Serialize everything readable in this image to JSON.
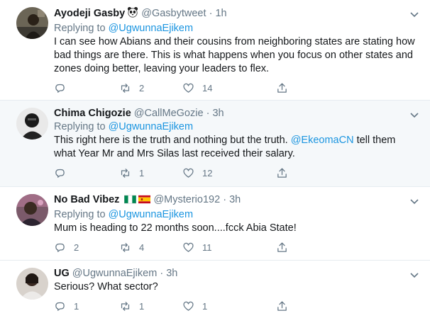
{
  "tweets": [
    {
      "name": "Ayodeji Gasby",
      "handle": "@Gasbytweet",
      "dot": "·",
      "time": "1h",
      "replying_prefix": "Replying to",
      "replying_to": "@UgwunnaEjikem",
      "text_plain": "I can see how Abians and their cousins from neighboring states are stating how bad things are there. This is what happens when you focus on other states and zones doing better, leaving your leaders to flex.",
      "reply_count": "",
      "retweet_count": "2",
      "like_count": "14",
      "emoji": "panda-face-icon",
      "highlight": false
    },
    {
      "name": "Chima Chigozie",
      "handle": "@CallMeGozie",
      "dot": "·",
      "time": "3h",
      "replying_prefix": "Replying to",
      "replying_to": "@UgwunnaEjikem",
      "text_pre": "This right here is the truth and nothing but the truth. ",
      "text_mention": "@EkeomaCN",
      "text_post": " tell them what Year Mr and Mrs Silas last received their salary.",
      "reply_count": "",
      "retweet_count": "1",
      "like_count": "12",
      "highlight": true
    },
    {
      "name": "No Bad Vibez",
      "handle": "@Mysterio192",
      "dot": "·",
      "time": "3h",
      "replying_prefix": "Replying to",
      "replying_to": "@UgwunnaEjikem",
      "text_plain": "Mum is heading to 22 months soon....fcck Abia State!",
      "reply_count": "2",
      "retweet_count": "4",
      "like_count": "11",
      "emoji": "nigeria-flag-icon, spain-flag-icon",
      "highlight": false
    },
    {
      "name": "UG",
      "handle": "@UgwunnaEjikem",
      "dot": "·",
      "time": "3h",
      "text_plain": "Serious? What sector?",
      "reply_count": "1",
      "retweet_count": "1",
      "like_count": "1",
      "highlight": false
    }
  ],
  "colors": {
    "link": "#1b95e0",
    "muted": "#657786",
    "highlight_bg": "#f5f8fa",
    "divider": "#e6ecf0"
  }
}
